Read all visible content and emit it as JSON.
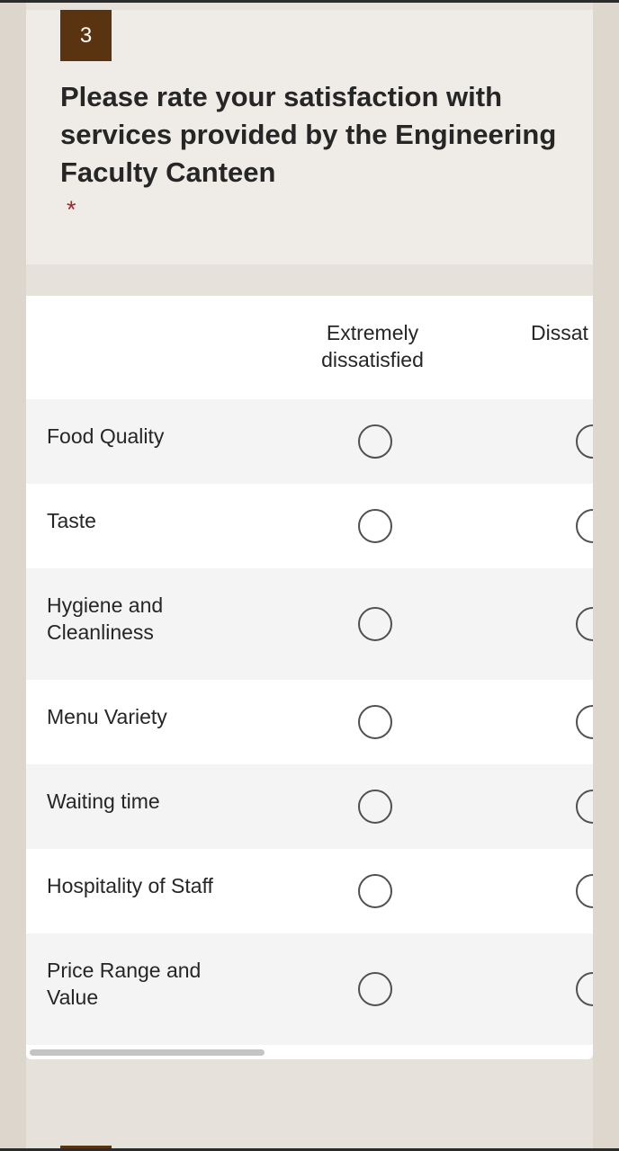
{
  "question": {
    "number": "3",
    "title": "Please rate your satisfaction with services provided by the Engineering Faculty Canteen",
    "required_mark": "*"
  },
  "matrix": {
    "columns": [
      "Extremely dissatisfied",
      "Dissat"
    ],
    "rows": [
      "Food Quality",
      "Taste",
      "Hygiene and Cleanliness",
      "Menu Variety",
      "Waiting time",
      "Hospitality of Staff",
      "Price Range and Value"
    ]
  },
  "colors": {
    "badge": "#5a3410",
    "required": "#a4262c",
    "text": "#262626",
    "row_shade": "#f4f4f4"
  }
}
